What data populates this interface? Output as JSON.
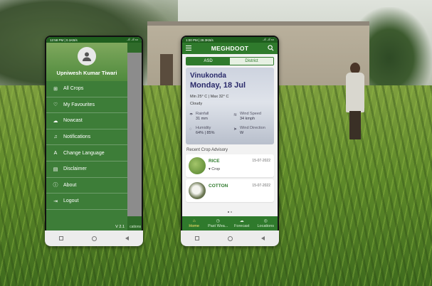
{
  "left_phone": {
    "status": {
      "time": "12:58 PM | 0.1KB/s",
      "right": "..ıl ..ıl ▭"
    },
    "drawer": {
      "user_name": "Upniwesh Kumar Tiwari",
      "items": [
        {
          "label": "All Crops",
          "icon": "grid-icon"
        },
        {
          "label": "My Favourites",
          "icon": "heart-icon"
        },
        {
          "label": "Nowcast",
          "icon": "cloud-icon"
        },
        {
          "label": "Notifications",
          "icon": "bell-icon"
        },
        {
          "label": "Change Language",
          "icon": "language-icon"
        },
        {
          "label": "Disclaimer",
          "icon": "document-icon"
        },
        {
          "label": "About",
          "icon": "info-icon"
        },
        {
          "label": "Logout",
          "icon": "logout-icon"
        }
      ],
      "version": "V 2.1",
      "peek_text": "cations"
    }
  },
  "right_phone": {
    "status": {
      "time": "1:00 PM | 28.3KB/s",
      "right": "..ıl ..ıl ▭"
    },
    "app_title": "MEGHDOOT",
    "toggle": {
      "left": "ASD",
      "right": "District"
    },
    "weather": {
      "place": "Vinukonda",
      "date": "Monday, 18 Jul",
      "minmax": "Min 25° C | Max 32° C",
      "condition": "Cloudy",
      "rainfall_label": "Rainfall",
      "rainfall_value": "31 mm",
      "wind_speed_label": "Wind Speed",
      "wind_speed_value": "34 kmph",
      "humidity_label": "Humidity",
      "humidity_value": "64% | 85%",
      "wind_dir_label": "Wind Direction",
      "wind_dir_value": "W"
    },
    "section_label": "Recent Crop Advisory",
    "crops": [
      {
        "name": "RICE",
        "date": "15-07-2022",
        "tag": "Crop"
      },
      {
        "name": "COTTON",
        "date": "15-07-2022",
        "tag": ""
      }
    ],
    "bottom_nav": [
      {
        "label": "Home",
        "icon": "home-icon"
      },
      {
        "label": "Past Wea...",
        "icon": "history-icon"
      },
      {
        "label": "Forecast",
        "icon": "forecast-icon"
      },
      {
        "label": "Locations",
        "icon": "location-icon"
      }
    ]
  }
}
